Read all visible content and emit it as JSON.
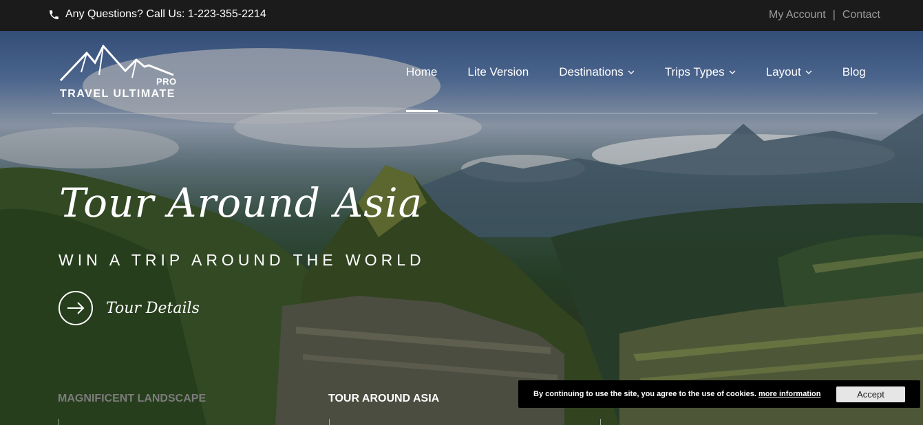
{
  "topbar": {
    "phone_text": "Any Questions? Call Us: 1-223-355-2214",
    "links": [
      "My Account",
      "Contact"
    ],
    "separator": "|"
  },
  "logo": {
    "pro": "PRO",
    "name": "TRAVEL ULTIMATE"
  },
  "nav": {
    "items": [
      {
        "label": "Home",
        "dropdown": false,
        "active": true
      },
      {
        "label": "Lite Version",
        "dropdown": false
      },
      {
        "label": "Destinations",
        "dropdown": true
      },
      {
        "label": "Trips Types",
        "dropdown": true
      },
      {
        "label": "Layout",
        "dropdown": true
      },
      {
        "label": "Blog",
        "dropdown": false
      }
    ]
  },
  "hero": {
    "title": "Tour Around Asia",
    "subtitle": "WIN A TRIP AROUND THE WORLD",
    "cta_label": "Tour Details"
  },
  "slide_tabs": [
    {
      "label": "MAGNIFICENT LANDSCAPE",
      "active": false
    },
    {
      "label": "TOUR AROUND ASIA",
      "active": true
    }
  ],
  "cookie": {
    "message": "By continuing to use the site, you agree to the use of cookies.",
    "more_link": "more information",
    "accept_label": "Accept"
  },
  "icons": {
    "phone": "phone-icon",
    "arrow": "arrow-right-icon",
    "chevron": "chevron-down-icon",
    "logo_mark": "mountain-icon"
  },
  "colors": {
    "topbar_bg": "#1b1b1b",
    "topbar_link": "#9a9a9a",
    "cookie_bg": "#000000",
    "accept_bg": "#e6e6e6"
  }
}
